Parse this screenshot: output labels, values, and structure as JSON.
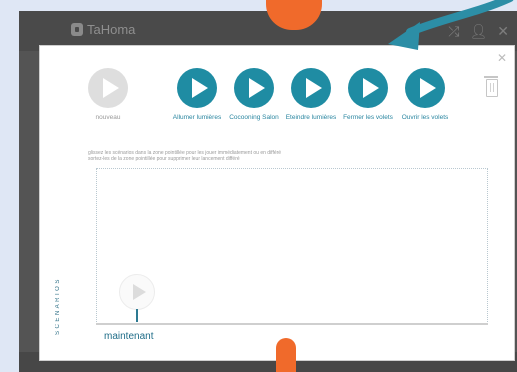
{
  "app": {
    "brand": "TaHoma"
  },
  "header_icons": [
    "shuffle-icon",
    "user-icon",
    "close-icon"
  ],
  "scenarios": [
    {
      "label": "nouveau",
      "enabled": false
    },
    {
      "label": "Allumer lumières",
      "enabled": true
    },
    {
      "label": "Cocooning Salon",
      "enabled": true
    },
    {
      "label": "Eteindre lumières",
      "enabled": true
    },
    {
      "label": "Fermer les volets",
      "enabled": true
    },
    {
      "label": "Ouvrir les volets",
      "enabled": true
    }
  ],
  "instructions": {
    "line1": "glissez les scénarios dans la zone pointillée pour les jouer immédiatement ou en différé",
    "line2": "sortez-les de la zone pointillée pour supprimer leur lancement différé"
  },
  "side_label": "SCENARIOS",
  "timeline": {
    "now_label": "maintenant"
  },
  "colors": {
    "accent": "#1f8ca3",
    "pointer": "#f06a2b",
    "chrome": "#545454",
    "background": "#dfe7f5"
  }
}
